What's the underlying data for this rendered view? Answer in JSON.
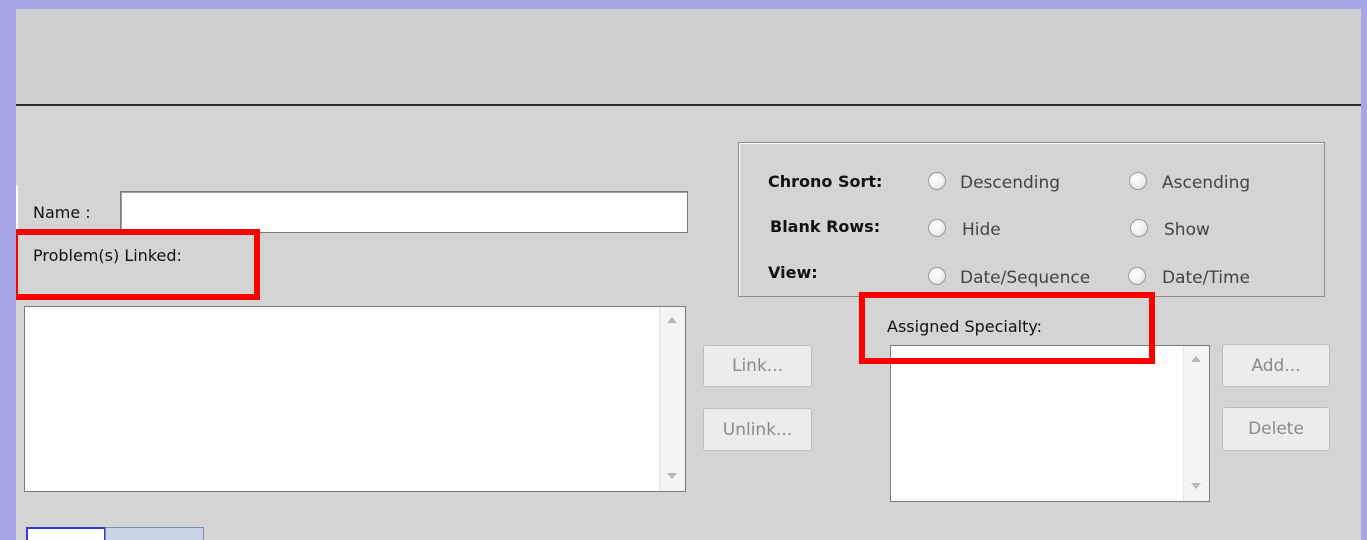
{
  "form": {
    "name_label": "Name :",
    "name_value": "",
    "problems_label": "Problem(s) Linked:",
    "link_button": "Link...",
    "unlink_button": "Unlink...",
    "specialty_label": "Assigned Specialty:",
    "add_button": "Add...",
    "delete_button": "Delete"
  },
  "options": {
    "chrono_sort_label": "Chrono Sort:",
    "chrono_descending": "Descending",
    "chrono_ascending": "Ascending",
    "blank_rows_label": "Blank Rows:",
    "blank_hide": "Hide",
    "blank_show": "Show",
    "view_label": "View:",
    "view_date_sequence": "Date/Sequence",
    "view_date_time": "Date/Time"
  },
  "colors": {
    "highlight": "#ff0000",
    "background": "#d4d4d4",
    "outer_border": "#a9a6e8"
  }
}
